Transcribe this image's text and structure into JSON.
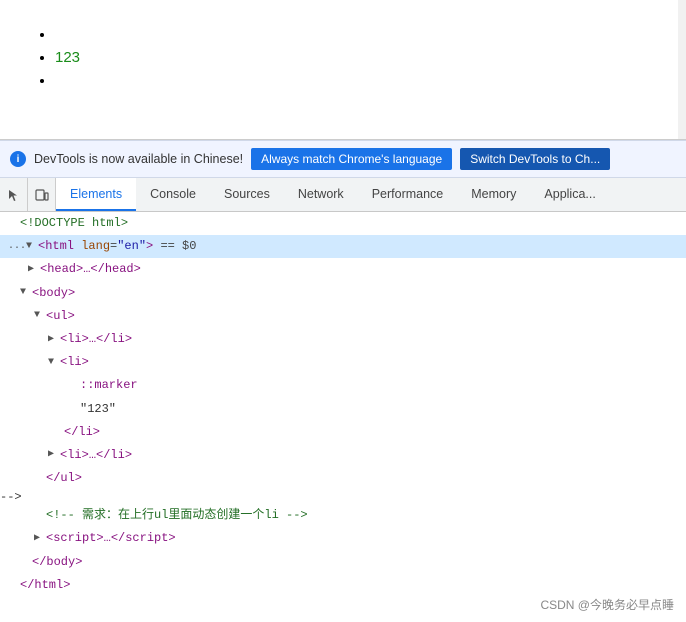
{
  "preview": {
    "list_items": [
      "",
      "123",
      ""
    ]
  },
  "notification": {
    "icon": "i",
    "message": "DevTools is now available in Chinese!",
    "button1": "Always match Chrome's language",
    "button2": "Switch DevTools to Ch..."
  },
  "tabs": {
    "icons": [
      "cursor",
      "box"
    ],
    "items": [
      {
        "label": "Elements",
        "active": true
      },
      {
        "label": "Console",
        "active": false
      },
      {
        "label": "Sources",
        "active": false
      },
      {
        "label": "Network",
        "active": false
      },
      {
        "label": "Performance",
        "active": false
      },
      {
        "label": "Memory",
        "active": false
      },
      {
        "label": "Applica...",
        "active": false
      }
    ]
  },
  "dom": {
    "lines": [
      {
        "indent": 0,
        "content": "<!DOCTYPE html>",
        "type": "doctype",
        "marker": "",
        "arrow": ""
      },
      {
        "indent": 0,
        "content": "",
        "type": "html-open",
        "marker": "...",
        "arrow": "▼",
        "selected": true
      },
      {
        "indent": 1,
        "content": "",
        "type": "head",
        "marker": "",
        "arrow": "▶"
      },
      {
        "indent": 1,
        "content": "",
        "type": "body-open",
        "marker": "",
        "arrow": "▼"
      },
      {
        "indent": 2,
        "content": "",
        "type": "ul-open",
        "marker": "",
        "arrow": "▼"
      },
      {
        "indent": 3,
        "content": "",
        "type": "li-collapsed1",
        "marker": "",
        "arrow": "▶"
      },
      {
        "indent": 3,
        "content": "",
        "type": "li-open",
        "marker": "",
        "arrow": "▼"
      },
      {
        "indent": 4,
        "content": "::marker",
        "type": "pseudo",
        "marker": "",
        "arrow": ""
      },
      {
        "indent": 4,
        "content": "\"123\"",
        "type": "text",
        "marker": "",
        "arrow": ""
      },
      {
        "indent": 3,
        "content": "",
        "type": "li-close",
        "marker": "",
        "arrow": ""
      },
      {
        "indent": 3,
        "content": "",
        "type": "li-collapsed2",
        "marker": "",
        "arrow": "▶"
      },
      {
        "indent": 2,
        "content": "",
        "type": "ul-close",
        "marker": "",
        "arrow": ""
      },
      {
        "indent": 2,
        "content": "",
        "type": "comment",
        "marker": "",
        "arrow": ""
      },
      {
        "indent": 2,
        "content": "",
        "type": "script",
        "marker": "",
        "arrow": "▶"
      },
      {
        "indent": 1,
        "content": "",
        "type": "body-close",
        "marker": "",
        "arrow": ""
      },
      {
        "indent": 0,
        "content": "",
        "type": "html-close",
        "marker": "",
        "arrow": ""
      }
    ]
  },
  "watermark": "CSDN @今晚务必早点睡"
}
